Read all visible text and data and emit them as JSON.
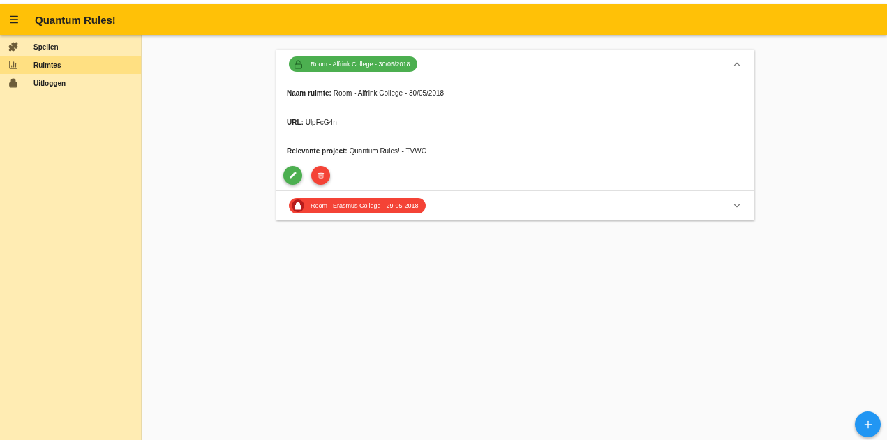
{
  "app_bar": {
    "title": "Quantum Rules!"
  },
  "sidebar": {
    "items": [
      {
        "label": "Spellen",
        "selected": false
      },
      {
        "label": "Ruimtes",
        "selected": true
      },
      {
        "label": "Uitloggen",
        "selected": false
      }
    ]
  },
  "rooms": [
    {
      "name": "Room - Alfrink College - 30/05/2018",
      "locked": false,
      "expanded": true,
      "details": [
        {
          "label": "Naam ruimte:",
          "value": "Room - Alfrink College - 30/05/2018"
        },
        {
          "label": "URL:",
          "value": "UlpFcG4n"
        },
        {
          "label": "Relevante project:",
          "value": "Quantum Rules! - TVWO"
        }
      ]
    },
    {
      "name": "Room - Erasmus College - 29-05-2018",
      "locked": true,
      "expanded": false
    }
  ]
}
